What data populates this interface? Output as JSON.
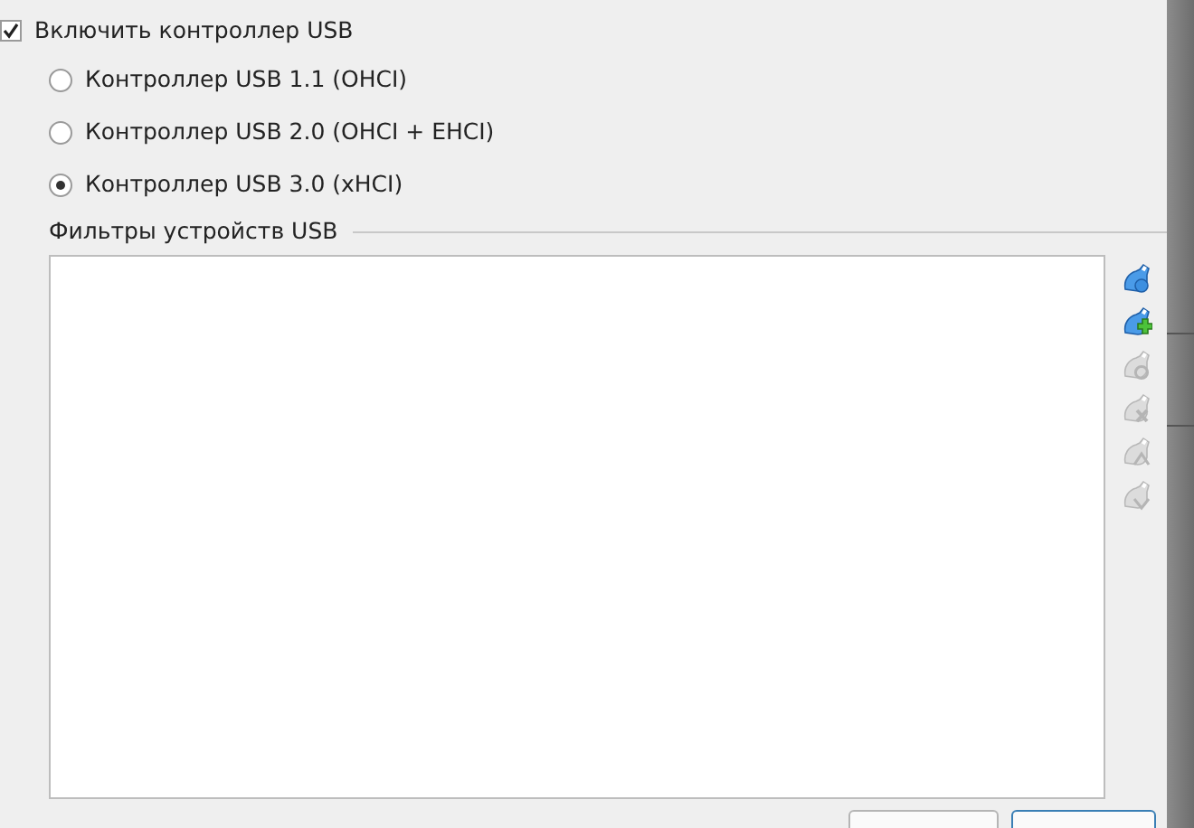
{
  "enable_usb": {
    "label": "Включить контроллер USB",
    "checked": true
  },
  "controllers": [
    {
      "label": "Контроллер USB 1.1 (OHCI)",
      "selected": false
    },
    {
      "label": "Контроллер USB 2.0 (OHCI + EHCI)",
      "selected": false
    },
    {
      "label": "Контроллер USB 3.0 (xHCI)",
      "selected": true
    }
  ],
  "filters": {
    "title": "Фильтры устройств USB"
  },
  "filter_tools": [
    {
      "kind": "plain",
      "disabled": false
    },
    {
      "kind": "add",
      "disabled": false
    },
    {
      "kind": "edit",
      "disabled": true
    },
    {
      "kind": "remove",
      "disabled": true
    },
    {
      "kind": "up",
      "disabled": true
    },
    {
      "kind": "down",
      "disabled": true
    }
  ]
}
